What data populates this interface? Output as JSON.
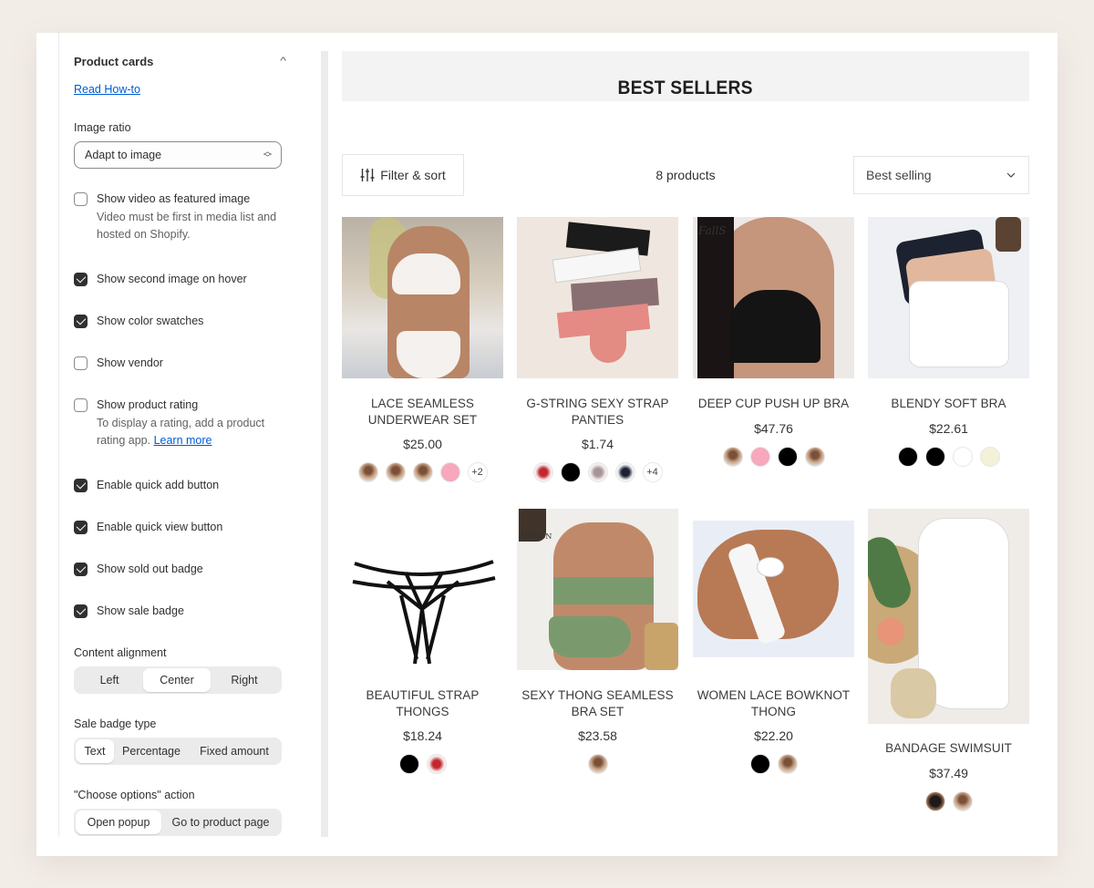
{
  "settings": {
    "section_title": "Product cards",
    "read_howto": "Read How-to",
    "image_ratio": {
      "label": "Image ratio",
      "value": "Adapt to image"
    },
    "checkboxes": [
      {
        "label": "Show video as featured image",
        "checked": false,
        "help": "Video must be first in media list and hosted on Shopify."
      },
      {
        "label": "Show second image on hover",
        "checked": true
      },
      {
        "label": "Show color swatches",
        "checked": true
      },
      {
        "label": "Show vendor",
        "checked": false
      },
      {
        "label": "Show product rating",
        "checked": false,
        "help": "To display a rating, add a product rating app.",
        "help_link": "Learn more"
      },
      {
        "label": "Enable quick add button",
        "checked": true
      },
      {
        "label": "Enable quick view button",
        "checked": true
      },
      {
        "label": "Show sold out badge",
        "checked": true
      },
      {
        "label": "Show sale badge",
        "checked": true
      }
    ],
    "content_alignment": {
      "label": "Content alignment",
      "options": [
        "Left",
        "Center",
        "Right"
      ],
      "selected": "Center"
    },
    "sale_badge_type": {
      "label": "Sale badge type",
      "options": [
        "Text",
        "Percentage",
        "Fixed amount"
      ],
      "selected": "Text"
    },
    "choose_options_action": {
      "label": "\"Choose options\" action",
      "options": [
        "Open popup",
        "Go to product page"
      ],
      "selected": "Open popup"
    }
  },
  "collection": {
    "title": "BEST SELLERS",
    "filter_label": "Filter & sort",
    "product_count": "8 products",
    "sort_value": "Best selling",
    "products": [
      {
        "name": "LACE SEAMLESS UNDERWEAR SET",
        "price": "$25.00",
        "image": "white-lace-lingerie",
        "swatches": [
          "photo",
          "photo",
          "photo",
          "#f7a8bd"
        ],
        "more": "+2"
      },
      {
        "name": "G-STRING SEXY STRAP PANTIES",
        "price": "$1.74",
        "image": "strap-panties-assortment",
        "swatches": [
          "photo-red",
          "#000000",
          "photo-mauve",
          "photo-navy"
        ],
        "more": "+4"
      },
      {
        "name": "DEEP CUP PUSH UP BRA",
        "price": "$47.76",
        "image": "black-push-up-bra",
        "swatches": [
          "photo",
          "#f7a8bd",
          "#000000",
          "photo"
        ],
        "more": ""
      },
      {
        "name": "BLENDY SOFT BRA",
        "price": "$22.61",
        "image": "soft-bras-flatlay",
        "swatches": [
          "#000000",
          "#000000",
          "#ffffff",
          "#f3f1d7"
        ],
        "more": ""
      },
      {
        "name": "BEAUTIFUL STRAP THONGS",
        "price": "$18.24",
        "image": "black-strap-thong",
        "swatches": [
          "#000000",
          "photo-red"
        ],
        "more": ""
      },
      {
        "name": "SEXY THONG SEAMLESS BRA SET",
        "price": "$23.58",
        "image": "green-bra-set",
        "swatches": [
          "photo"
        ],
        "more": ""
      },
      {
        "name": "WOMEN LACE BOWKNOT THONG",
        "price": "$22.20",
        "image": "white-lace-bowknot",
        "swatches": [
          "#000000",
          "photo"
        ],
        "more": ""
      },
      {
        "name": "BANDAGE SWIMSUIT",
        "price": "$37.49",
        "image": "white-swimsuit-flatlay",
        "swatches": [
          "photo-dark",
          "photo"
        ],
        "more": ""
      }
    ]
  }
}
